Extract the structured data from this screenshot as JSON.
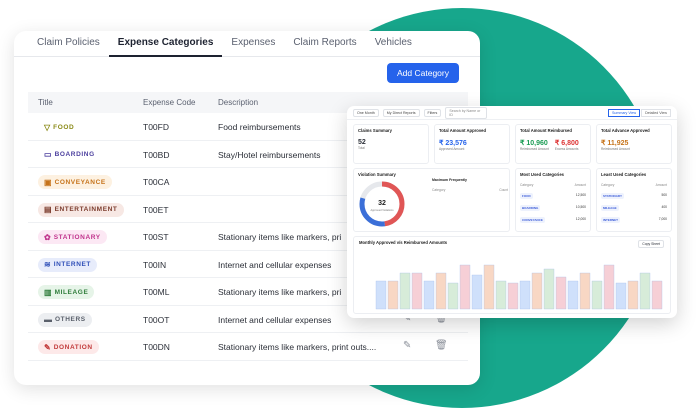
{
  "tabs": [
    {
      "label": "Claim Policies"
    },
    {
      "label": "Expense Categories"
    },
    {
      "label": "Expenses"
    },
    {
      "label": "Claim Reports"
    },
    {
      "label": "Vehicles"
    }
  ],
  "add_button": "Add Category",
  "table": {
    "headers": {
      "title": "Title",
      "code": "Expense Code",
      "description": "Description"
    },
    "rows": [
      {
        "label": "FOOD",
        "icon": "food-icon",
        "code": "T00FD",
        "description": "Food reimbursements",
        "color": "#8a8a16",
        "bg": "#ffffff"
      },
      {
        "label": "BOARDING",
        "icon": "bed-icon",
        "code": "T00BD",
        "description": "Stay/Hotel reimbursements",
        "color": "#4b3f9e",
        "bg": "#ffffff"
      },
      {
        "label": "CONVEYANCE",
        "icon": "car-icon",
        "code": "T00CA",
        "description": "",
        "color": "#c6731a",
        "bg": "#fdf1e1"
      },
      {
        "label": "ENTERTAINMENT",
        "icon": "film-icon",
        "code": "T00ET",
        "description": "",
        "color": "#7b3b2c",
        "bg": "#f7e8e4"
      },
      {
        "label": "STATIONARY",
        "icon": "palette-icon",
        "code": "T00ST",
        "description": "Stationary items like markers, pri",
        "color": "#c0338c",
        "bg": "#fce8f4"
      },
      {
        "label": "INTERNET",
        "icon": "wifi-icon",
        "code": "T00IN",
        "description": "Internet and cellular expenses",
        "color": "#2f4fb8",
        "bg": "#e7ecfb"
      },
      {
        "label": "MILEAGE",
        "icon": "gauge-icon",
        "code": "T00ML",
        "description": "Stationary items like markers, pri",
        "color": "#2f7d3b",
        "bg": "#e6f4e8"
      },
      {
        "label": "OTHERS",
        "icon": "dots-icon",
        "code": "T00OT",
        "description": "Internet and cellular expenses",
        "color": "#5a606b",
        "bg": "#eceef1"
      },
      {
        "label": "DONATION",
        "icon": "pen-icon",
        "code": "T00DN",
        "description": "Stationary items like markers, print outs....",
        "color": "#c23b3b",
        "bg": "#fde9e9"
      }
    ]
  },
  "dashboard": {
    "filters": [
      "One Month",
      "My Direct Reports",
      "Filters"
    ],
    "search_placeholder": "Search by Name or ID",
    "view_toggle": [
      "Summary View",
      "Detailed View"
    ],
    "kpis": [
      {
        "title": "Claims Summary",
        "value": "52",
        "sub": "Total",
        "color": "#222"
      },
      {
        "title": "Total Amount Approved",
        "value": "₹ 23,576",
        "sub": "Approved Amount",
        "color": "#2563eb"
      },
      {
        "title": "Total Amount Reimbursed",
        "value": "₹ 10,960",
        "value2": "₹ 6,800",
        "sub": "Reimbursed Amount",
        "sub2": "Excess Amounts",
        "color": "#1a9b53",
        "color2": "#d33"
      },
      {
        "title": "Total Advance Approved",
        "value": "₹ 11,925",
        "sub": "Reimbursed Amount",
        "color": "#c6731a"
      }
    ],
    "violation": {
      "title": "Violation Summary",
      "count": "32",
      "count_label": "Approved Violations"
    },
    "max_category": {
      "title": "Maximum Frequently",
      "col1": "Category",
      "col2": "Count"
    },
    "most_used": {
      "title": "Most Used Categories",
      "col1": "Category",
      "col2": "Amount",
      "items": [
        {
          "name": "FOOD",
          "amt": "12,500"
        },
        {
          "name": "BOARDING",
          "amt": "10,500"
        },
        {
          "name": "CONVEYANCE",
          "amt": "12,000"
        }
      ]
    },
    "least_used": {
      "title": "Least Used Categories",
      "col1": "Category",
      "col2": "Amount",
      "items": [
        {
          "name": "STATIONARY",
          "amt": "500"
        },
        {
          "name": "MILEAGE",
          "amt": "400"
        },
        {
          "name": "INTERNET",
          "amt": "7,000"
        }
      ]
    },
    "bar_chart_title": "Monthly Approved v/s Reimbursed Amounts",
    "export_label": "Copy Sheet"
  },
  "colors": {
    "accent": "#2563eb",
    "blob": "#17a78c"
  }
}
